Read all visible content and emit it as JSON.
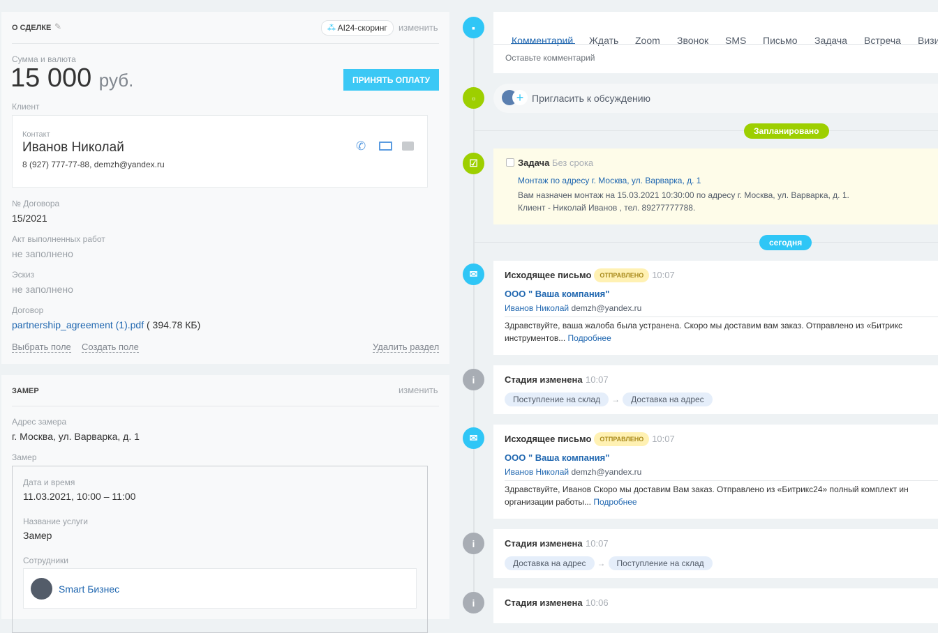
{
  "deal": {
    "title": "О СДЕЛКЕ",
    "ai_scoring": "AI24-скоринг",
    "edit": "изменить",
    "amount_label": "Сумма и валюта",
    "amount": "15 000",
    "currency": "руб.",
    "accept_payment": "ПРИНЯТЬ ОПЛАТУ",
    "client_label": "Клиент",
    "contact_label": "Контакт",
    "contact_name": "Иванов Николай",
    "contact_details": "8 (927) 777-77-88, demzh@yandex.ru",
    "contract_no_label": "№ Договора",
    "contract_no": "15/2021",
    "act_label": "Акт выполненных работ",
    "act_value": "не заполнено",
    "sketch_label": "Эскиз",
    "sketch_value": "не заполнено",
    "contract_label": "Договор",
    "contract_file": "partnership_agreement (1).pdf",
    "contract_size": "( 394.78 КБ)",
    "select_field": "Выбрать поле",
    "create_field": "Создать поле",
    "delete_section": "Удалить раздел"
  },
  "measure": {
    "title": "ЗАМЕР",
    "edit": "изменить",
    "address_label": "Адрес замера",
    "address": "г. Москва, ул. Варварка, д. 1",
    "measure_label": "Замер",
    "datetime_label": "Дата и время",
    "datetime": "11.03.2021, 10:00 – 11:00",
    "service_label": "Название услуги",
    "service": "Замер",
    "staff_label": "Сотрудники",
    "staff_name": "Smart Бизнес"
  },
  "timeline": {
    "tabs": [
      "Комментарий",
      "Ждать",
      "Zoom",
      "Звонок",
      "SMS",
      "Письмо",
      "Задача",
      "Встреча",
      "Визи"
    ],
    "comment_placeholder": "Оставьте комментарий",
    "invite": "Пригласить к обсуждению",
    "planned": "Запланировано",
    "today": "сегодня",
    "task": {
      "title": "Задача",
      "deadline": "Без срока",
      "subject": "Монтаж по адресу г. Москва, ул. Варварка, д. 1",
      "line1": "Вам назначен монтаж на 15.03.2021 10:30:00 по адресу г. Москва, ул. Варварка, д. 1.",
      "line2": "Клиент - Николай Иванов , тел. 89277777788."
    },
    "email1": {
      "title": "Исходящее письмо",
      "status": "ОТПРАВЛЕНО",
      "time": "10:07",
      "company": "ООО \" Ваша компания\"",
      "to_name": "Иванов Николай",
      "to_email": "demzh@yandex.ru",
      "body1": "Здравствуйте, ваша жалоба была устранена.  Скоро мы доставим вам заказ. Отправлено из «Битрикс",
      "body2": "инструментов...",
      "more": "Подробнее"
    },
    "stage1": {
      "title": "Стадия изменена",
      "time": "10:07",
      "from": "Поступление на склад",
      "to": "Доставка на адрес"
    },
    "email2": {
      "title": "Исходящее письмо",
      "status": "ОТПРАВЛЕНО",
      "time": "10:07",
      "company": "ООО \" Ваша компания\"",
      "to_name": "Иванов Николай",
      "to_email": "demzh@yandex.ru",
      "body1": "Здравствуйте, Иванов Скоро мы доставим Вам заказ. Отправлено из «Битрикс24» полный комплект ин",
      "body2": "организации работы...",
      "more": "Подробнее"
    },
    "stage2": {
      "title": "Стадия изменена",
      "time": "10:07",
      "from": "Доставка на адрес",
      "to": "Поступление на склад"
    },
    "stage3": {
      "title": "Стадия изменена",
      "time": "10:06"
    }
  }
}
